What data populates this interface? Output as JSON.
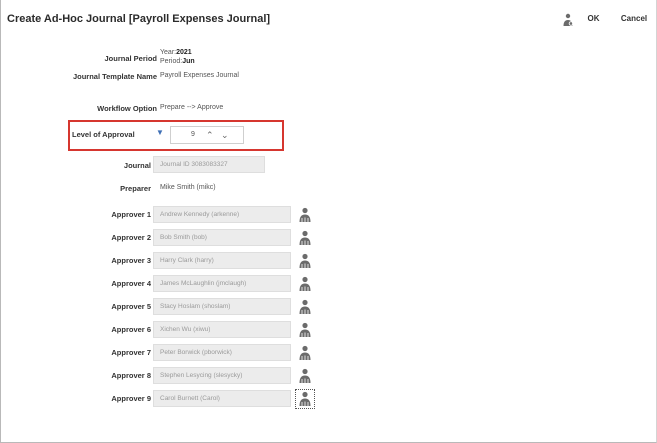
{
  "header": {
    "title": "Create Ad-Hoc Journal [Payroll Expenses Journal]",
    "ok_label": "OK",
    "cancel_label": "Cancel"
  },
  "form": {
    "journal_period_label": "Journal Period",
    "year_prefix": "Year:",
    "year_value": "2021",
    "period_prefix": "Period:",
    "period_value": "Jun",
    "template_label": "Journal Template Name",
    "template_value": "Payroll Expenses Journal",
    "workflow_label": "Workflow Option",
    "workflow_value": "Prepare --> Approve",
    "approval_label": "Level of Approval",
    "approval_value": "9",
    "journal_label": "Journal",
    "journal_value": "Journal ID 3083083327",
    "preparer_label": "Preparer",
    "preparer_value": "Mike Smith (mikc)"
  },
  "approvers": [
    {
      "label": "Approver 1",
      "value": "Andrew Kennedy (arkenne)"
    },
    {
      "label": "Approver 2",
      "value": "Bob Smith (bob)"
    },
    {
      "label": "Approver 3",
      "value": "Harry Clark (harry)"
    },
    {
      "label": "Approver 4",
      "value": "James McLaughlin (jmclaugh)"
    },
    {
      "label": "Approver 5",
      "value": "Stacy Hoslam (shoslam)"
    },
    {
      "label": "Approver 6",
      "value": "Xichen Wu (xiwu)"
    },
    {
      "label": "Approver 7",
      "value": "Peter Borwick (pborwick)"
    },
    {
      "label": "Approver 8",
      "value": "Stephen Lesycing (slesycky)"
    },
    {
      "label": "Approver 9",
      "value": "Carol Burnett (Carol)"
    }
  ],
  "icons": {
    "header_icon": "person-search-icon",
    "approver_icon": "person-search-icon",
    "caret_icon": "caret-down-icon",
    "up_icon": "chevron-up-icon",
    "down_icon": "chevron-down-icon"
  },
  "colors": {
    "highlight_border": "#d6362f",
    "caret": "#3f6fb5",
    "field_bg": "#ececec",
    "icon": "#6b6b6b"
  }
}
